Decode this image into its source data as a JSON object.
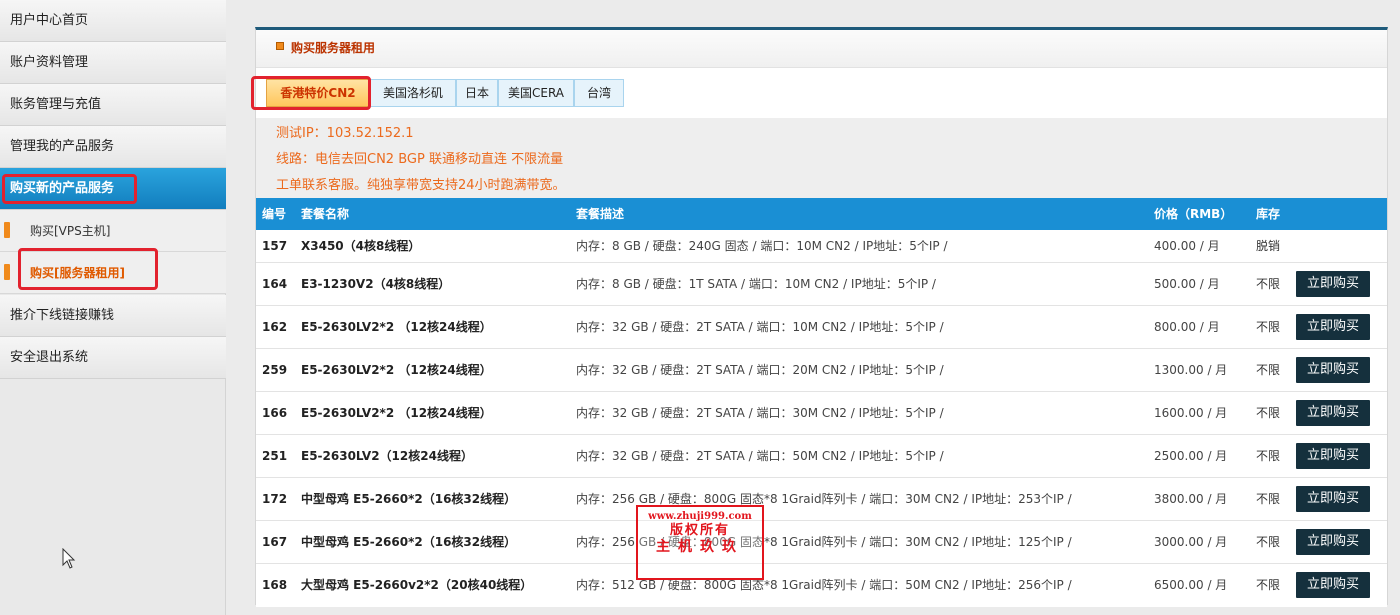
{
  "sidebar": {
    "items": [
      {
        "label": "用户中心首页"
      },
      {
        "label": "账户资料管理"
      },
      {
        "label": "账务管理与充值"
      },
      {
        "label": "管理我的产品服务"
      },
      {
        "label": "购买新的产品服务"
      },
      {
        "label": "推介下线链接赚钱"
      },
      {
        "label": "安全退出系统"
      }
    ],
    "subitems": [
      {
        "label": "购买[VPS主机]"
      },
      {
        "label": "购买[服务器租用]"
      }
    ]
  },
  "panel": {
    "title": "购买服务器租用"
  },
  "tabs": [
    {
      "label": "香港特价CN2"
    },
    {
      "label": "美国洛杉矶"
    },
    {
      "label": "日本"
    },
    {
      "label": "美国CERA"
    },
    {
      "label": "台湾"
    }
  ],
  "info": {
    "line1": "测试IP：103.52.152.1",
    "line2": "线路：电信去回CN2 BGP 联通移动直连 不限流量",
    "line3": "工单联系客服。纯独享带宽支持24小时跑满带宽。"
  },
  "table": {
    "headers": {
      "id": "编号",
      "name": "套餐名称",
      "desc": "套餐描述",
      "price": "价格（RMB）",
      "stock": "库存"
    },
    "rows": [
      {
        "id": "157",
        "name": "X3450（4核8线程）",
        "desc": "内存：8 GB / 硬盘：240G 固态 / 端口：10M CN2 / IP地址：5个IP /",
        "price": "400.00 / 月",
        "stock": "脱销",
        "button": ""
      },
      {
        "id": "164",
        "name": "E3-1230V2（4核8线程）",
        "desc": "内存：8 GB / 硬盘：1T SATA / 端口：10M CN2 / IP地址：5个IP /",
        "price": "500.00 / 月",
        "stock": "不限",
        "button": "立即购买"
      },
      {
        "id": "162",
        "name": "E5-2630LV2*2 （12核24线程）",
        "desc": "内存：32 GB / 硬盘：2T SATA / 端口：10M CN2 / IP地址：5个IP /",
        "price": "800.00 / 月",
        "stock": "不限",
        "button": "立即购买"
      },
      {
        "id": "259",
        "name": "E5-2630LV2*2 （12核24线程）",
        "desc": "内存：32 GB / 硬盘：2T SATA / 端口：20M CN2 / IP地址：5个IP /",
        "price": "1300.00 / 月",
        "stock": "不限",
        "button": "立即购买"
      },
      {
        "id": "166",
        "name": "E5-2630LV2*2 （12核24线程）",
        "desc": "内存：32 GB / 硬盘：2T SATA / 端口：30M CN2 / IP地址：5个IP /",
        "price": "1600.00 / 月",
        "stock": "不限",
        "button": "立即购买"
      },
      {
        "id": "251",
        "name": "E5-2630LV2（12核24线程）",
        "desc": "内存：32 GB / 硬盘：2T SATA / 端口：50M CN2 / IP地址：5个IP /",
        "price": "2500.00 / 月",
        "stock": "不限",
        "button": "立即购买"
      },
      {
        "id": "172",
        "name": "中型母鸡 E5-2660*2（16核32线程）",
        "desc": "内存：256 GB / 硬盘：800G 固态*8 1Graid阵列卡 / 端口：30M CN2 / IP地址：253个IP /",
        "price": "3800.00 / 月",
        "stock": "不限",
        "button": "立即购买"
      },
      {
        "id": "167",
        "name": "中型母鸡 E5-2660*2（16核32线程）",
        "desc": "内存：256 GB / 硬盘：800G 固态*8 1Graid阵列卡 / 端口：30M CN2 / IP地址：125个IP /",
        "price": "3000.00 / 月",
        "stock": "不限",
        "button": "立即购买"
      },
      {
        "id": "168",
        "name": "大型母鸡 E5-2660v2*2（20核40线程）",
        "desc": "内存：512 GB / 硬盘：800G 固态*8 1Graid阵列卡 / 端口：50M CN2 / IP地址：256个IP /",
        "price": "6500.00 / 月",
        "stock": "不限",
        "button": "立即购买"
      }
    ]
  },
  "watermark": {
    "line1": "www.zhuji999.com",
    "line2": "版权所有",
    "line3": "主机玖玖"
  },
  "colors": {
    "accent": "#1a8fd4",
    "nav_active": "#1984c8",
    "info_text": "#ec6a1d",
    "button": "#15303d",
    "annotation": "#e2222e"
  }
}
